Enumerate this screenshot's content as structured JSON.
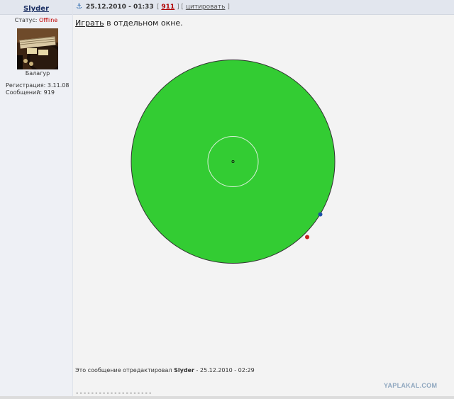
{
  "user": {
    "name": "Slyder",
    "status_label": "Статус:",
    "status_value": "Offline",
    "rank": "Балагур",
    "registration": "Регистрация: 3.11.08",
    "messages": "Сообщений: 919"
  },
  "post": {
    "anchor_icon": "anchor-icon",
    "date": "25.12.2010 - 01:33",
    "bracket_open": "[",
    "number": "911",
    "bracket_mid": "] [",
    "quote_label": "цитировать",
    "bracket_close": "]",
    "play_link": "Играть",
    "play_rest": " в отдельном окне.",
    "edited_prefix": "Это сообщение отредактировал ",
    "edited_user": "Slyder",
    "edited_suffix": " - 25.12.2010 - 02:29",
    "separator": "--------------------",
    "watermark": "YAPLAKAL.COM"
  },
  "game": {
    "disc_color": "#33cc33",
    "disc_stroke": "#333333",
    "inner_ring_color": "#d8f0d8",
    "blue_dot_color": "#1f4fa8",
    "red_dot_color": "#c62020"
  },
  "colors": {
    "username": "#1b2f63",
    "offline": "#c00000",
    "post_number": "#b00000"
  }
}
